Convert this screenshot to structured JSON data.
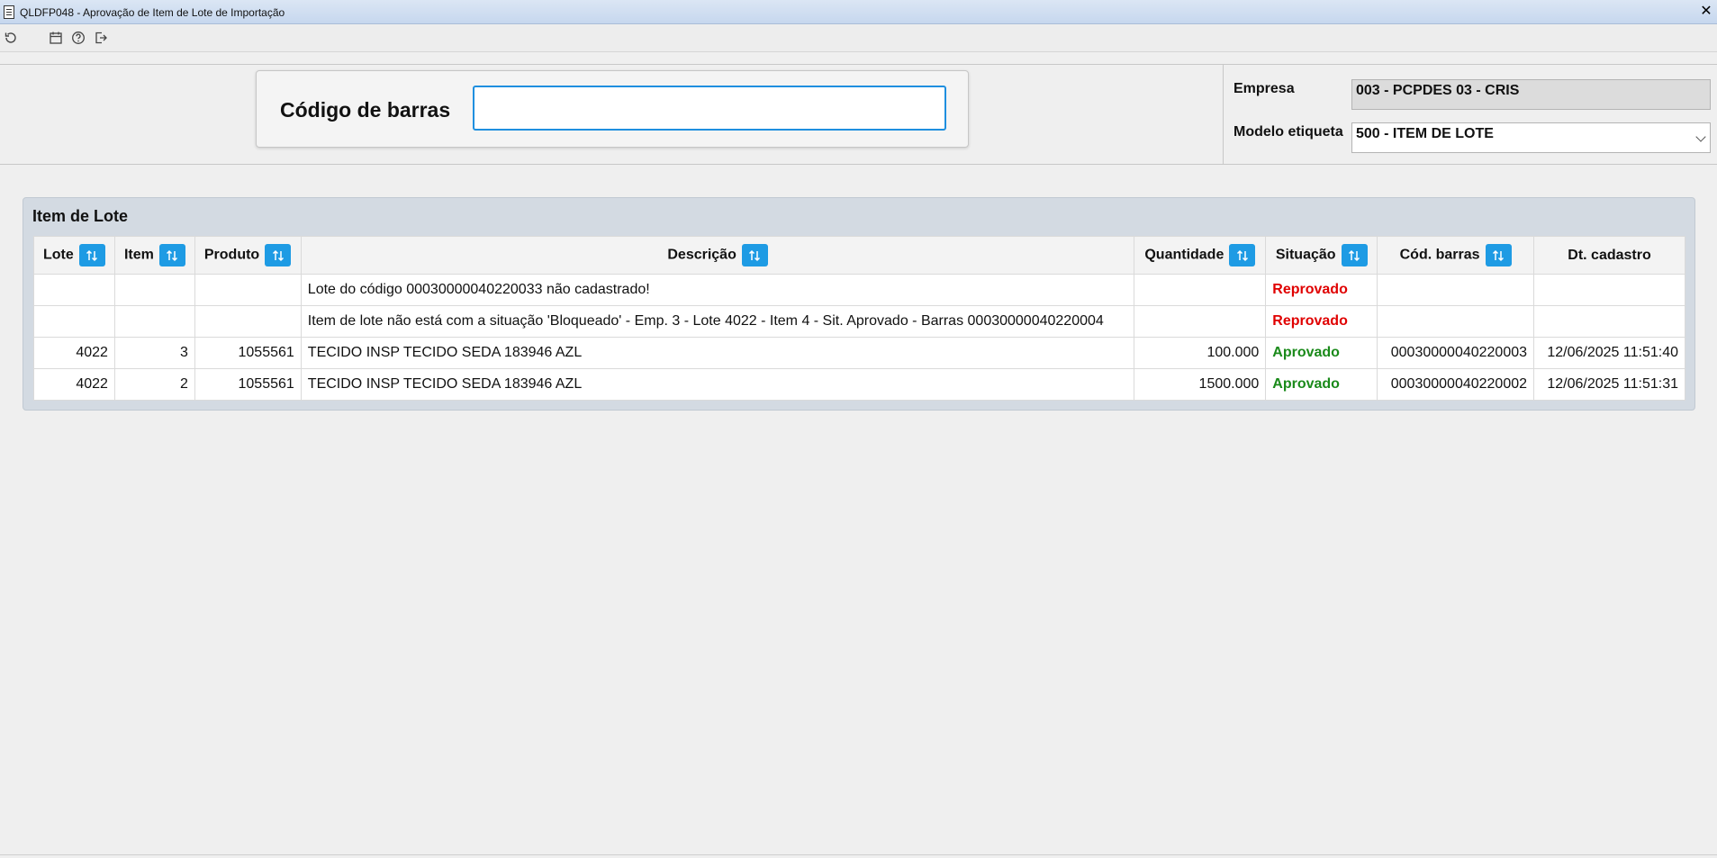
{
  "window": {
    "title": "QLDFP048 - Aprovação de Item de Lote de Importação"
  },
  "toolbar": {
    "icons": [
      "refresh-icon",
      "calendar-icon",
      "help-icon",
      "exit-icon"
    ]
  },
  "barcode": {
    "label": "Código de barras",
    "value": ""
  },
  "empresa": {
    "label": "Empresa",
    "value": "003 - PCPDES 03 - CRIS"
  },
  "modelo": {
    "label": "Modelo etiqueta",
    "value": "500 - ITEM DE LOTE"
  },
  "panel": {
    "title": "Item de Lote",
    "columns": [
      "Lote",
      "Item",
      "Produto",
      "Descrição",
      "Quantidade",
      "Situação",
      "Cód. barras",
      "Dt. cadastro"
    ],
    "rows": [
      {
        "lote": "",
        "item": "",
        "produto": "",
        "descricao": "Lote do código 00030000040220033 não cadastrado!",
        "quantidade": "",
        "situacao": "Reprovado",
        "cod_barras": "",
        "dt_cadastro": ""
      },
      {
        "lote": "",
        "item": "",
        "produto": "",
        "descricao": "Item de lote não está com a situação 'Bloqueado' - Emp. 3 - Lote 4022 - Item 4 - Sit. Aprovado - Barras 00030000040220004",
        "quantidade": "",
        "situacao": "Reprovado",
        "cod_barras": "",
        "dt_cadastro": ""
      },
      {
        "lote": "4022",
        "item": "3",
        "produto": "1055561",
        "descricao": "TECIDO INSP TECIDO SEDA 183946 AZL",
        "quantidade": "100.000",
        "situacao": "Aprovado",
        "cod_barras": "00030000040220003",
        "dt_cadastro": "12/06/2025 11:51:40"
      },
      {
        "lote": "4022",
        "item": "2",
        "produto": "1055561",
        "descricao": "TECIDO INSP TECIDO SEDA 183946 AZL",
        "quantidade": "1500.000",
        "situacao": "Aprovado",
        "cod_barras": "00030000040220002",
        "dt_cadastro": "12/06/2025 11:51:31"
      }
    ]
  },
  "colors": {
    "accent": "#1e9be4",
    "reprovado": "#e00000",
    "aprovado": "#1a8a1a"
  }
}
